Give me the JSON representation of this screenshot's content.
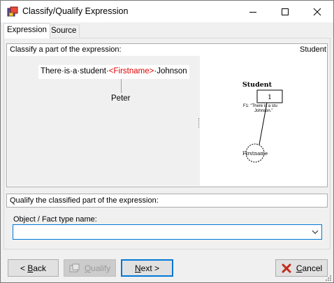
{
  "window": {
    "title": "Classify/Qualify Expression"
  },
  "tabs": [
    {
      "label": "Expression",
      "active": true
    },
    {
      "label": "Source",
      "active": false
    }
  ],
  "classify": {
    "header": "Classify a part of the expression:",
    "selected_type": "Student",
    "expression": {
      "before": "There·is·a·student·",
      "role": "<Firstname>",
      "after": "·Johnson"
    },
    "value": "Peter"
  },
  "diagram": {
    "entity_name": "Student",
    "entity_ref": "1",
    "fact_note_line1": "F1: \"There is a stu",
    "fact_note_line2": "Johnson.\"",
    "role_name": "Firstname"
  },
  "qualify": {
    "header": "Qualify the classified part of the expression:",
    "field_label": "Object / Fact type name:",
    "field_value": ""
  },
  "buttons": {
    "back_prefix": "< ",
    "back_underlined": "B",
    "back_rest": "ack",
    "qualify_underlined": "Q",
    "qualify_rest": "ualify",
    "next_underlined": "N",
    "next_rest": "ext >",
    "cancel_underlined": "C",
    "cancel_rest": "ancel"
  },
  "colors": {
    "role_text": "#e00000",
    "focus_accent": "#0078d7",
    "cancel_icon": "#c42b1c"
  }
}
